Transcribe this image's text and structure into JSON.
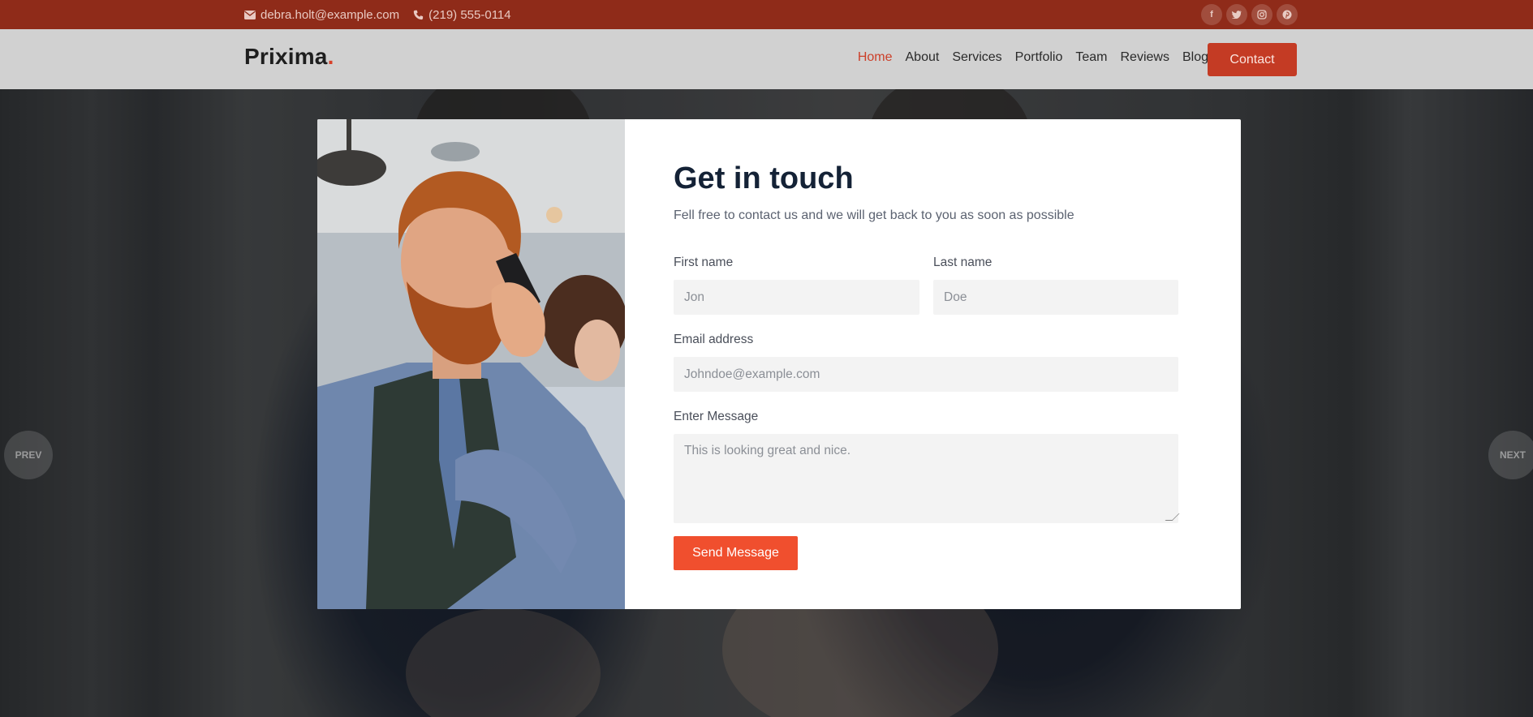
{
  "topbar": {
    "email": "debra.holt@example.com",
    "phone": "(219) 555-0114",
    "socials": [
      {
        "icon": "facebook-icon",
        "glyph": "f"
      },
      {
        "icon": "twitter-icon",
        "glyph": "t"
      },
      {
        "icon": "instagram-icon",
        "glyph": "◎"
      },
      {
        "icon": "pinterest-icon",
        "glyph": "p"
      }
    ]
  },
  "header": {
    "logo": "Prixima",
    "logo_dot": ".",
    "nav": [
      "Home",
      "About",
      "Services",
      "Portfolio",
      "Team",
      "Reviews",
      "Blog"
    ],
    "active_nav": "Home",
    "contact_label": "Contact"
  },
  "slider": {
    "prev_label": "PREV",
    "next_label": "NEXT"
  },
  "contact_form": {
    "title": "Get in touch",
    "subtitle": "Fell free to contact us and we will get back to you as soon as possible",
    "first_name_label": "First name",
    "first_name_placeholder": "Jon",
    "last_name_label": "Last name",
    "last_name_placeholder": "Doe",
    "email_label": "Email address",
    "email_placeholder": "Johndoe@example.com",
    "message_label": "Enter Message",
    "message_placeholder": "This is looking great and nice.",
    "submit_label": "Send Message"
  },
  "colors": {
    "topbar": "#8f2b19",
    "accent": "#f04f2e",
    "active_nav": "#cc3f29",
    "title": "#142236"
  }
}
